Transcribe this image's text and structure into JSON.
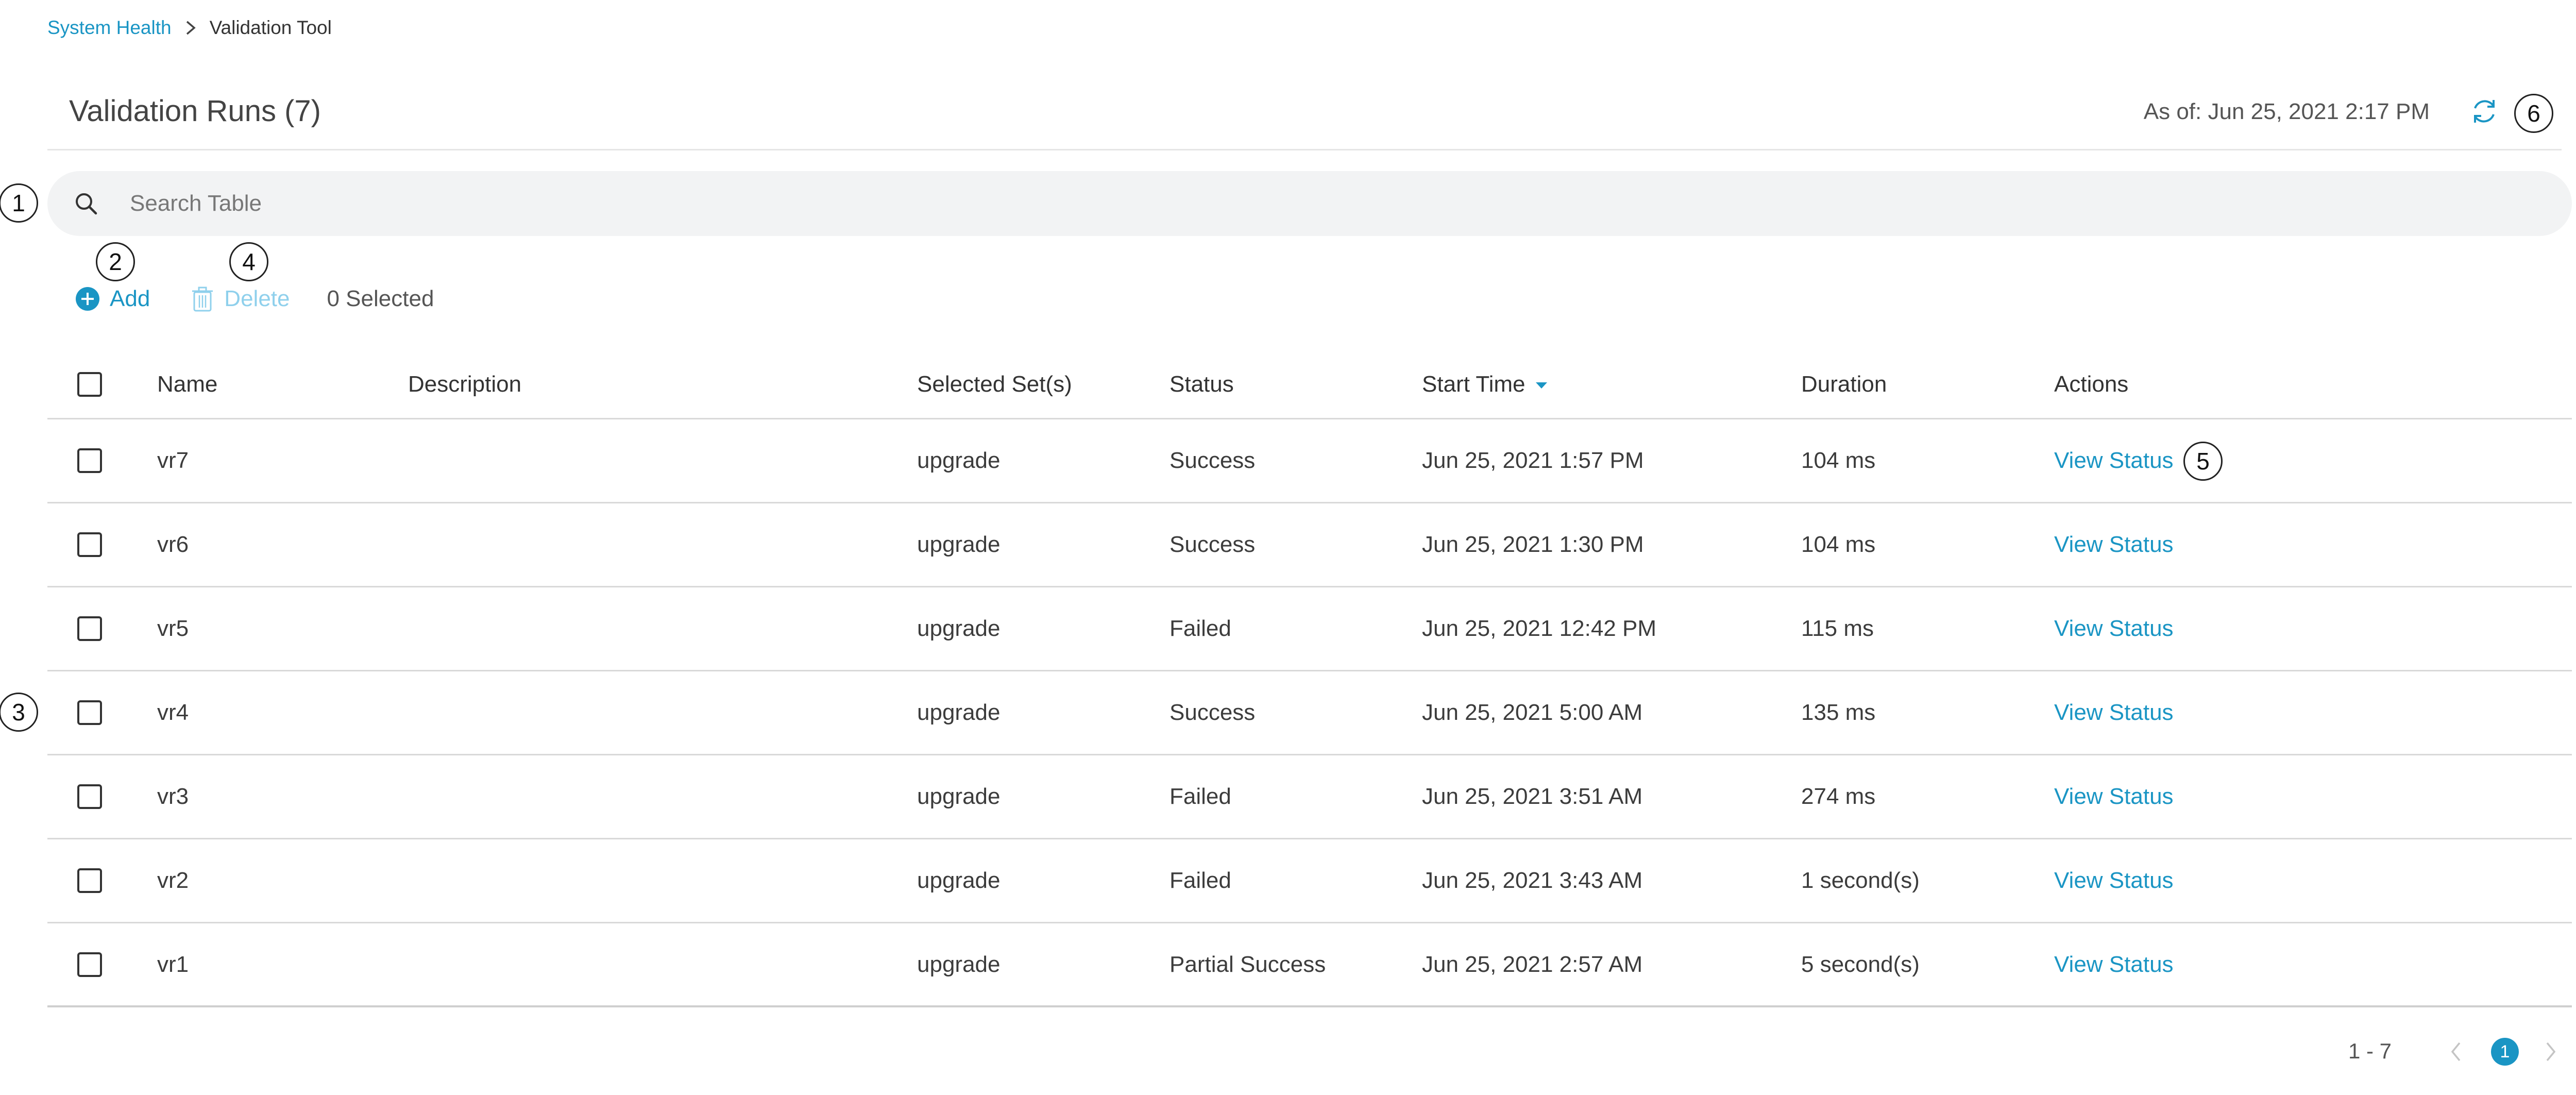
{
  "breadcrumb": {
    "parent": "System Health",
    "separator_icon": "chevron-right-icon",
    "current": "Validation Tool"
  },
  "header": {
    "title": "Validation Runs (7)",
    "as_of": "As of: Jun 25, 2021 2:17 PM",
    "refresh_icon": "refresh-icon"
  },
  "search": {
    "placeholder": "Search Table",
    "value": ""
  },
  "toolbar": {
    "add_label": "Add",
    "delete_label": "Delete",
    "selected_label": "0 Selected"
  },
  "callouts": [
    "1",
    "2",
    "3",
    "4",
    "5",
    "6"
  ],
  "table": {
    "columns": [
      "Name",
      "Description",
      "Selected Set(s)",
      "Status",
      "Start Time",
      "Duration",
      "Actions"
    ],
    "sorted_column": "Start Time",
    "rows": [
      {
        "name": "vr7",
        "description": "",
        "set": "upgrade",
        "status": "Success",
        "start": "Jun 25, 2021 1:57 PM",
        "duration": "104 ms",
        "action": "View Status"
      },
      {
        "name": "vr6",
        "description": "",
        "set": "upgrade",
        "status": "Success",
        "start": "Jun 25, 2021 1:30 PM",
        "duration": "104 ms",
        "action": "View Status"
      },
      {
        "name": "vr5",
        "description": "",
        "set": "upgrade",
        "status": "Failed",
        "start": "Jun 25, 2021 12:42 PM",
        "duration": "115 ms",
        "action": "View Status"
      },
      {
        "name": "vr4",
        "description": "",
        "set": "upgrade",
        "status": "Success",
        "start": "Jun 25, 2021 5:00 AM",
        "duration": "135 ms",
        "action": "View Status"
      },
      {
        "name": "vr3",
        "description": "",
        "set": "upgrade",
        "status": "Failed",
        "start": "Jun 25, 2021 3:51 AM",
        "duration": "274 ms",
        "action": "View Status"
      },
      {
        "name": "vr2",
        "description": "",
        "set": "upgrade",
        "status": "Failed",
        "start": "Jun 25, 2021 3:43 AM",
        "duration": "1 second(s)",
        "action": "View Status"
      },
      {
        "name": "vr1",
        "description": "",
        "set": "upgrade",
        "status": "Partial Success",
        "start": "Jun 25, 2021 2:57 AM",
        "duration": "5 second(s)",
        "action": "View Status"
      }
    ]
  },
  "pagination": {
    "range": "1 - 7",
    "current_page": "1"
  },
  "colors": {
    "accent": "#1a95c4",
    "accent_disabled": "#8fd0ec",
    "search_bg": "#f2f3f4"
  }
}
